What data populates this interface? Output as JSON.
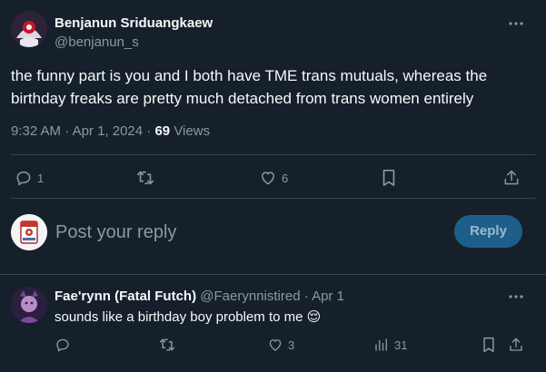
{
  "tweet": {
    "author_name": "Benjanun Sriduangkaew",
    "author_handle": "@benjanun_s",
    "text": "the funny part is you and I both have TME trans mutuals, whereas the birthday freaks are pretty much detached from trans women entirely",
    "time": "9:32 AM",
    "separator": "·",
    "date": "Apr 1, 2024",
    "views_count": "69",
    "views_label": "Views",
    "reply_count": "1",
    "like_count": "6"
  },
  "composer": {
    "placeholder": "Post your reply",
    "reply_button": "Reply"
  },
  "reply": {
    "author_name": "Fae'rynn (Fatal Futch)",
    "author_handle": "@Faerynnistired",
    "separator": "·",
    "date": "Apr 1",
    "text": "sounds like a birthday boy problem to me",
    "emoji": "😌",
    "like_count": "3",
    "views_count": "31"
  },
  "colors": {
    "background": "#15202b",
    "divider": "#38444d",
    "muted_text": "#8b98a5",
    "primary_text": "#f7f9f9",
    "reply_button_bg": "#1e5f8a",
    "reply_button_text": "#9bb9cf"
  }
}
